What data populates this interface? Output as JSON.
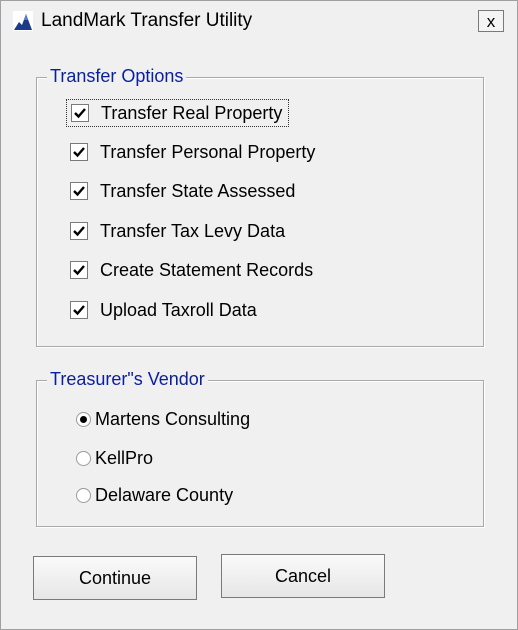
{
  "window": {
    "title": "LandMark Transfer Utility",
    "close_label": "x"
  },
  "transfer_options": {
    "legend": "Transfer Options",
    "items": [
      {
        "label": "Transfer Real Property",
        "checked": true
      },
      {
        "label": "Transfer Personal Property",
        "checked": true
      },
      {
        "label": "Transfer State Assessed",
        "checked": true
      },
      {
        "label": "Transfer Tax Levy Data",
        "checked": true
      },
      {
        "label": "Create Statement Records",
        "checked": true
      },
      {
        "label": "Upload Taxroll Data",
        "checked": true
      }
    ]
  },
  "vendor": {
    "legend": "Treasurer\"s Vendor",
    "options": [
      {
        "label": "Martens Consulting",
        "selected": true
      },
      {
        "label": "KellPro",
        "selected": false
      },
      {
        "label": "Delaware County",
        "selected": false
      }
    ]
  },
  "buttons": {
    "continue_label": "Continue",
    "cancel_label": "Cancel"
  },
  "colors": {
    "legend_text": "#0a1f9c",
    "background": "#f0f0f0"
  }
}
